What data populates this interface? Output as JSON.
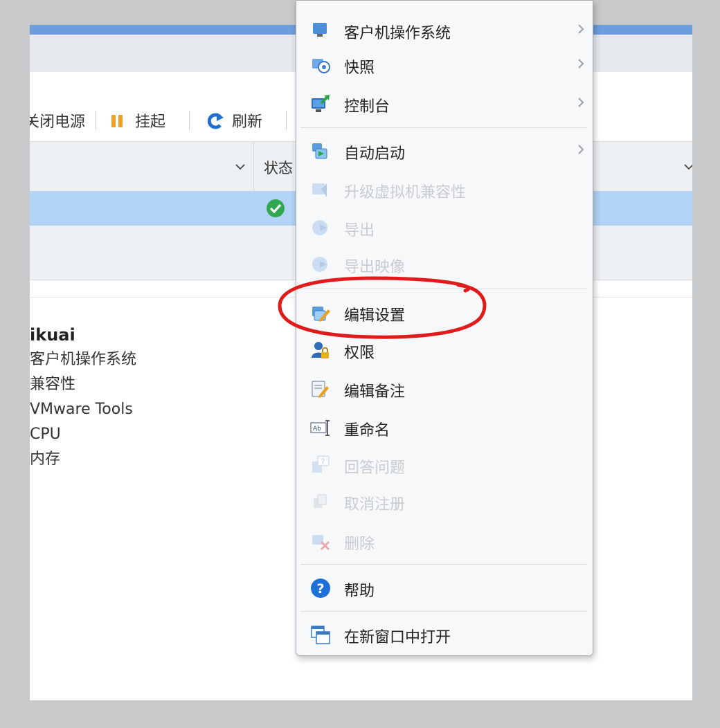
{
  "toolbar": {
    "power_off_label": "关闭电源",
    "suspend_label": "挂起",
    "refresh_label": "刷新"
  },
  "grid": {
    "status_header": "状态"
  },
  "details": {
    "vm_name": "ikuai",
    "properties": [
      "客户机操作系统",
      "兼容性",
      "VMware Tools",
      "CPU",
      "内存"
    ]
  },
  "context_menu": {
    "items": [
      {
        "label": "客户机操作系统",
        "icon": "guest-os-icon",
        "enabled": true,
        "submenu": true
      },
      {
        "label": "快照",
        "icon": "snapshot-icon",
        "enabled": true,
        "submenu": true
      },
      {
        "label": "控制台",
        "icon": "console-icon",
        "enabled": true,
        "submenu": true
      },
      {
        "label": "自动启动",
        "icon": "autostart-icon",
        "enabled": true,
        "submenu": true
      },
      {
        "label": "升级虚拟机兼容性",
        "icon": "upgrade-compat-icon",
        "enabled": false,
        "submenu": false
      },
      {
        "label": "导出",
        "icon": "export-icon",
        "enabled": false,
        "submenu": false
      },
      {
        "label": "导出映像",
        "icon": "export-image-icon",
        "enabled": false,
        "submenu": false
      },
      {
        "label": "编辑设置",
        "icon": "edit-settings-icon",
        "enabled": true,
        "submenu": false
      },
      {
        "label": "权限",
        "icon": "permissions-icon",
        "enabled": true,
        "submenu": false
      },
      {
        "label": "编辑备注",
        "icon": "edit-notes-icon",
        "enabled": true,
        "submenu": false
      },
      {
        "label": "重命名",
        "icon": "rename-icon",
        "enabled": true,
        "submenu": false
      },
      {
        "label": "回答问题",
        "icon": "answer-question-icon",
        "enabled": false,
        "submenu": false
      },
      {
        "label": "取消注册",
        "icon": "unregister-icon",
        "enabled": false,
        "submenu": false
      },
      {
        "label": "删除",
        "icon": "delete-icon",
        "enabled": false,
        "submenu": false
      },
      {
        "label": "帮助",
        "icon": "help-icon",
        "enabled": true,
        "submenu": false
      },
      {
        "label": "在新窗口中打开",
        "icon": "new-window-icon",
        "enabled": true,
        "submenu": false
      }
    ]
  },
  "colors": {
    "selection": "#b3d4f7",
    "annotation": "#e01b1b",
    "suspend_icon": "#f0a020",
    "refresh_icon": "#1f6fd0",
    "status_ok": "#2fa84f",
    "help_icon": "#1e6fd6"
  }
}
